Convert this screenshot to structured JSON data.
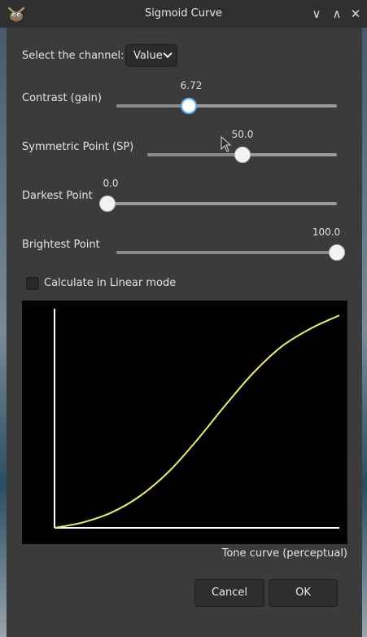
{
  "window": {
    "title": "Sigmoid Curve",
    "buttons": {
      "minimize": "∨",
      "maximize": "∧",
      "close": "✕"
    }
  },
  "channel": {
    "label": "Select the channel:",
    "value": "Value"
  },
  "sliders": [
    {
      "id": "contrast",
      "label": "Contrast (gain)",
      "value_text": "6.72",
      "fraction": 0.33
    },
    {
      "id": "symmetric",
      "label": "Symmetric Point (SP)",
      "value_text": "50.0",
      "fraction": 0.5
    },
    {
      "id": "darkest",
      "label": "Darkest Point",
      "value_text": "0.0",
      "fraction": 0.0
    },
    {
      "id": "brightest",
      "label": "Brightest Point",
      "value_text": "100.0",
      "fraction": 1.0
    }
  ],
  "linear_mode": {
    "label": "Calculate in Linear mode",
    "checked": false
  },
  "curve": {
    "caption": "Tone curve (perceptual)",
    "line_color": "#e9f060",
    "axis_color": "#ffffff",
    "points": [
      [
        0,
        0
      ],
      [
        0.1,
        0.025
      ],
      [
        0.2,
        0.07
      ],
      [
        0.3,
        0.145
      ],
      [
        0.4,
        0.255
      ],
      [
        0.5,
        0.4
      ],
      [
        0.6,
        0.56
      ],
      [
        0.7,
        0.71
      ],
      [
        0.8,
        0.83
      ],
      [
        0.9,
        0.91
      ],
      [
        1.0,
        0.97
      ]
    ]
  },
  "buttons": {
    "cancel": "Cancel",
    "ok": "OK"
  },
  "colors": {
    "accent": "#58b6e8",
    "background": "#3b3b3b"
  }
}
